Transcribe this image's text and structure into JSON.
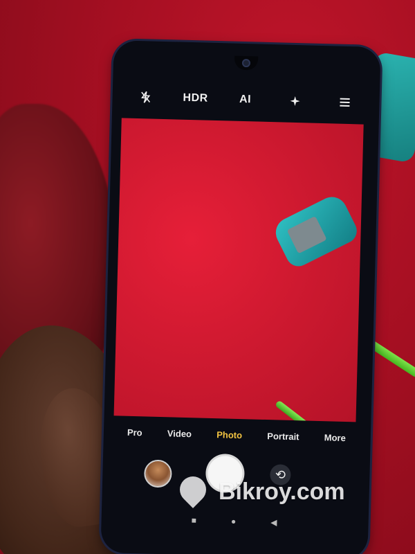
{
  "camera": {
    "topbar": {
      "flash_icon": "flash-off-icon",
      "hdr_label": "HDR",
      "ai_label": "AI",
      "beauty_icon": "sparkle-icon",
      "menu_icon": "hamburger-menu-icon"
    },
    "modes": [
      "Pro",
      "Video",
      "Photo",
      "Portrait",
      "More"
    ],
    "active_mode": "Photo",
    "shutter_icon": "shutter-button",
    "switch_icon": "switch-camera-icon",
    "gallery_icon": "gallery-thumbnail"
  },
  "navbar": {
    "recents_icon": "square-icon",
    "home_icon": "circle-icon",
    "back_icon": "triangle-back-icon"
  },
  "watermark": {
    "text": "Bikroy.com"
  },
  "colors": {
    "active_mode": "#f4c542",
    "background": "#a50f22"
  }
}
